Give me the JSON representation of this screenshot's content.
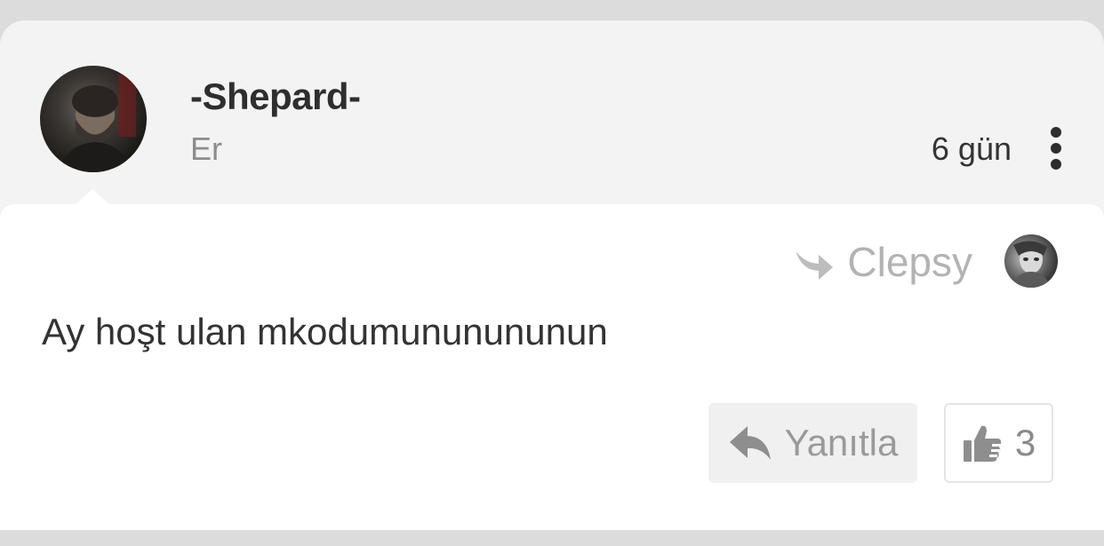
{
  "post": {
    "author": {
      "name": "-Shepard-",
      "rank": "Er",
      "avatar_icon": "user-avatar-photo"
    },
    "time_ago": "6 gün",
    "menu_icon": "more-vertical-icon",
    "reply_to": {
      "name": "Clepsy",
      "icon": "reply-arrow-icon",
      "avatar_icon": "user-avatar-photo"
    },
    "message": "Ay hoşt ulan mkodumununununun",
    "actions": {
      "reply_label": "Yanıtla",
      "reply_icon": "reply-icon",
      "like_icon": "thumbs-up-icon",
      "like_count": "3"
    }
  },
  "colors": {
    "page_background": "#dcdcdc",
    "header_background": "#f3f3f3",
    "body_background": "#ffffff",
    "muted_text": "#b3b3b3"
  }
}
